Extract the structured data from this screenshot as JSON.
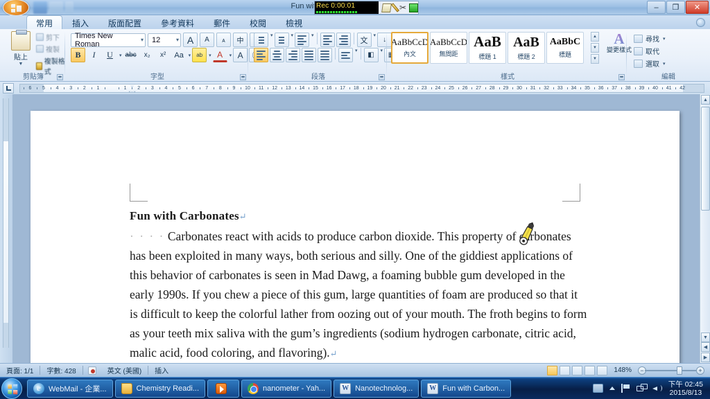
{
  "window": {
    "title": "Fun with Carbonates - Microsoft Word",
    "minimize_label": "–",
    "restore_label": "❐",
    "close_label": "✕",
    "help_icon": "help-icon"
  },
  "recorder": {
    "status_text": "Rec 0:00:01",
    "icons": [
      "note-icon",
      "pen-icon",
      "scissors-icon",
      "stop-icon"
    ],
    "scissors_glyph": "✂"
  },
  "quick_access": {
    "items": [
      "save-icon",
      "undo-icon",
      "redo-icon"
    ]
  },
  "ribbon": {
    "tabs": [
      {
        "label": "常用",
        "active": true
      },
      {
        "label": "插入",
        "active": false
      },
      {
        "label": "版面配置",
        "active": false
      },
      {
        "label": "參考資料",
        "active": false
      },
      {
        "label": "郵件",
        "active": false
      },
      {
        "label": "校閱",
        "active": false
      },
      {
        "label": "檢視",
        "active": false
      }
    ],
    "clipboard": {
      "group_label": "剪貼簿",
      "paste_label": "貼上",
      "paste_arrow": "▼",
      "cut_label": "剪下",
      "copy_label": "複製",
      "format_painter_label": "複製格式"
    },
    "font": {
      "group_label": "字型",
      "font_name": "Times New Roman",
      "font_size": "12",
      "arrow": "▾",
      "grow_font": "A",
      "shrink_font": "A",
      "clear_format": "ᴀ",
      "phonetic": "中",
      "char_border": "A",
      "bold": "B",
      "italic": "I",
      "underline": "U",
      "strikethrough": "abc",
      "subscript": "x₂",
      "superscript": "x²",
      "change_case": "Aa",
      "highlight": "ab",
      "font_color": "A",
      "text_effect": "A",
      "circle_char": "Ⓐ"
    },
    "paragraph": {
      "group_label": "段落",
      "buttons": [
        "bullets-icon",
        "numbering-icon",
        "multilevel-list-icon",
        "decrease-indent-icon",
        "increase-indent-icon",
        "asian-layout-icon",
        "sort-icon",
        "show-marks-icon",
        "align-left-icon",
        "align-center-icon",
        "align-right-icon",
        "justify-icon",
        "distribute-icon",
        "line-spacing-icon",
        "shading-icon",
        "borders-icon"
      ]
    },
    "styles": {
      "group_label": "樣式",
      "items": [
        {
          "sample": "AaBbCcD",
          "name": "內文",
          "size": 13,
          "bold": false,
          "selected": true
        },
        {
          "sample": "AaBbCcD",
          "name": "無間距",
          "size": 13,
          "bold": false,
          "selected": false
        },
        {
          "sample": "AaB",
          "name": "標題 1",
          "size": 21,
          "bold": true,
          "selected": false
        },
        {
          "sample": "AaB",
          "name": "標題 2",
          "size": 20,
          "bold": true,
          "selected": false
        },
        {
          "sample": "AaBbC",
          "name": "標題",
          "size": 14,
          "bold": true,
          "selected": false
        }
      ],
      "prefix_mark": "↵",
      "scroll_up": "▲",
      "scroll_down": "▼",
      "more": "▼",
      "change_styles_label": "變更樣式",
      "change_styles_sample": "A"
    },
    "editing": {
      "group_label": "編輯",
      "find_label": "尋找",
      "replace_label": "取代",
      "select_label": "選取",
      "arrow": "▾"
    },
    "dialog_launcher": "⬌"
  },
  "ruler": {
    "tab_selector": "tab-stop-icon",
    "left_numbers": [
      "7",
      "6",
      "5",
      "4",
      "3",
      "2",
      "1"
    ],
    "right_numbers": [
      "1",
      "2",
      "3",
      "4",
      "5",
      "6",
      "7",
      "8",
      "9",
      "10",
      "11",
      "12",
      "13",
      "14",
      "15",
      "16",
      "17",
      "18",
      "19",
      "20",
      "21",
      "22",
      "23",
      "24",
      "25",
      "26",
      "27",
      "28",
      "29",
      "30",
      "31",
      "32",
      "33",
      "34",
      "35",
      "36",
      "37",
      "38",
      "39",
      "40",
      "41",
      "42"
    ]
  },
  "document": {
    "title_line": "Fun with Carbonates",
    "paragraph_indent_dots": "· · · ·",
    "pilcrow": "↵",
    "lines": [
      "Carbonates react with acids to produce carbon dioxide. This property of",
      "carbonates has been exploited in many ways, both serious and silly. One of the",
      "giddiest applications of this behavior of carbonates is seen in Mad Dawg, a foaming",
      "bubble gum developed in the early 1990s. If you chew a piece of this gum, large",
      "quantities of foam are produced so that it is difficult to keep the colorful lather from",
      "oozing out of your mouth. The froth begins to form as your teeth mix saliva with the",
      "gum’s ingredients (sodium hydrogen carbonate, citric acid, malic acid, food coloring,",
      "and flavoring)."
    ],
    "cursor": "pencil-cursor"
  },
  "status": {
    "page": "頁面: 1/1",
    "words": "字數: 428",
    "proofing": "proofing-errors-icon",
    "language": "英文 (美國)",
    "insert_mode": "插入",
    "views": [
      "print-layout-view",
      "full-screen-view",
      "web-layout-view",
      "outline-view",
      "draft-view"
    ],
    "zoom": "148%",
    "zoom_out": "−",
    "zoom_in": "+"
  },
  "taskbar": {
    "start": "start-orb",
    "items": [
      {
        "label": "WebMail - 企業...",
        "icon": "internet-explorer-icon"
      },
      {
        "label": "Chemistry Readi...",
        "icon": "folder-icon"
      },
      {
        "label": "",
        "icon": "media-player-icon"
      },
      {
        "label": "nanometer - Yah...",
        "icon": "chrome-icon"
      },
      {
        "label": "Nanotechnolog...",
        "icon": "word-icon"
      },
      {
        "label": "Fun with Carbon...",
        "icon": "word-icon"
      }
    ],
    "tray": [
      "keyboard-layout-icon",
      "show-hidden-icons-arrow",
      "action-flag-icon",
      "network-icon",
      "volume-icon"
    ],
    "clock_time": "下午 02:45",
    "clock_date": "2015/8/13"
  }
}
